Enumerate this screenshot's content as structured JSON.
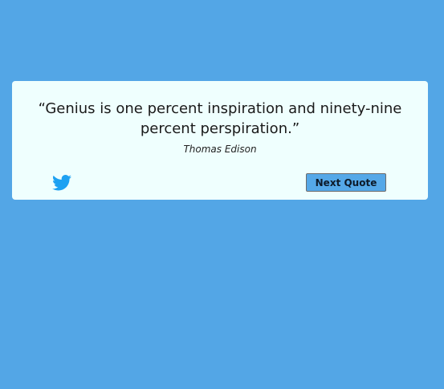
{
  "theme": {
    "background_color": "#53a6e6",
    "card_color": "#effffe",
    "twitter_color": "#1da1f2",
    "button_color": "#55a8e8"
  },
  "quote": {
    "text": "“Genius is one percent inspiration and ninety-nine percent perspiration.”",
    "author": "Thomas Edison"
  },
  "actions": {
    "tweet_icon": "twitter-bird-icon",
    "next_label": "Next Quote"
  }
}
